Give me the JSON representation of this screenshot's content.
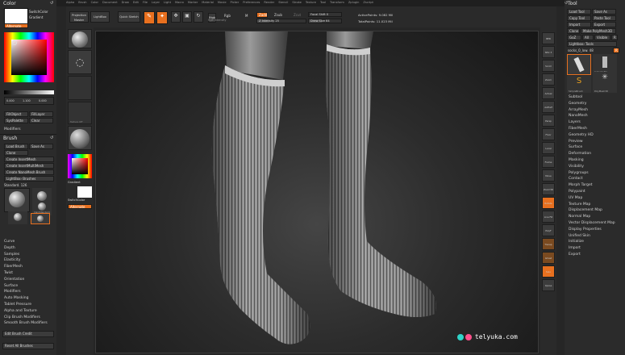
{
  "menu": {
    "items": [
      "Alpha",
      "Brush",
      "Color",
      "Document",
      "Draw",
      "Edit",
      "File",
      "Layer",
      "Light",
      "Macro",
      "Marker",
      "Material",
      "Movie",
      "Picker",
      "Preferences",
      "Render",
      "Stencil",
      "Stroke",
      "Texture",
      "Tool",
      "Transform",
      "Zplugin",
      "Zscript"
    ]
  },
  "toolbar": {
    "projection_label": "Projection Master",
    "lightbox_label": "LightBox",
    "quicksketch_label": "Quick Sketch",
    "edit_label": "Edit",
    "draw_label": "Draw",
    "move_label": "Move",
    "scale_label": "Scale",
    "rotate_label": "Rotate",
    "mrgb_label": "Mrgb",
    "rgb_label": "Rgb",
    "m_label": "M",
    "rgb_intensity_label": "Rgb Intensity",
    "zadd_label": "Zadd",
    "zsub_label": "Zsub",
    "zcut_label": "Zcut",
    "z_intensity_label": "Z Intensity 25",
    "focal_shift_label": "Focal Shift 0",
    "draw_size_label": "Draw Size 64",
    "active_points_label": "ActivePoints: 9.082 Mil",
    "total_points_label": "TotalPoints: 11.023 Mil"
  },
  "left": {
    "color_title": "Color",
    "switchcolor": "SwitchColor",
    "gradient": "Gradient",
    "alternate": "Alternate",
    "slider_values": [
      "0.000",
      "1.100",
      "0.000"
    ],
    "fill_object": "FillObject",
    "fill_layer": "FillLayer",
    "sys_palette": "SysPalette",
    "clear": "Clear",
    "modifiers": "Modifiers",
    "brush_title": "Brush",
    "load_brush": "Load Brush",
    "save_as": "Save As",
    "clone": "Clone",
    "lightbox_brushes": "LightBox› Brushes",
    "create_insertmesh": "Create InsertMesh",
    "create_insertmultimesh": "Create InsertMultiMesh",
    "create_nanomesh": "Create NanoMesh Brush",
    "standard_label": "Standard. 126",
    "brush_slots": [
      "Standard",
      "ClayBuildup",
      "DamStandard",
      "Move"
    ],
    "menu_items": [
      "Curve",
      "Depth",
      "Samples",
      "Elasticity",
      "FiberMesh",
      "Twist",
      "Orientation",
      "Surface",
      "Modifiers",
      "Auto Masking",
      "Tablet Pressure",
      "Alpha and Texture",
      "Clip Brush Modifiers",
      "Smooth Brush Modifiers"
    ],
    "edit_brush_credit": "Edit Brush Credit",
    "reset_all_brushes": "Reset All Brushes"
  },
  "shelf": {
    "texture_off": "Texture Off",
    "gradient": "Gradient",
    "switchcolor": "SwitchColor",
    "alternate": "Alternate"
  },
  "rightshelf": {
    "labels": [
      "BPR",
      "SPix 3",
      "Scroll",
      "Zoom",
      "Actual",
      "AAHalf",
      "Persp",
      "Floor",
      "Local",
      "Frame",
      "Move",
      "Zoom3D",
      "Rotate",
      "Line Fill",
      "PolyF",
      "Transp",
      "Ghost",
      "Solo",
      "Xpose"
    ]
  },
  "tool": {
    "title": "Tool",
    "load_tool": "Load Tool",
    "save_as": "Save As",
    "copy_tool": "Copy Tool",
    "paste_tool": "Paste Tool",
    "import": "Import",
    "export": "Export",
    "clone": "Clone",
    "make_polymesh": "Make PolyMesh3D",
    "goz": "GoZ",
    "all": "All",
    "visible": "Visible",
    "r": "R",
    "lightbox_tools": "Lightbox› Tools",
    "socks_label": "socks_0_low. 48",
    "thumb_labels": [
      "socks_0_low",
      "Cylinder3D",
      "PolyMesh3D",
      "SimpleBrush",
      "PM3D_Sock"
    ],
    "menu_items": [
      "Subtool",
      "Geometry",
      "ArrayMesh",
      "NanoMesh",
      "Layers",
      "FiberMesh",
      "Geometry HD",
      "Preview",
      "Surface",
      "Deformation",
      "Masking",
      "Visibility",
      "Polygroups",
      "Contact",
      "Morph Target",
      "Polypaint",
      "UV Map",
      "Texture Map",
      "Displacement Map",
      "Normal Map",
      "Vector Displacement Map",
      "Display Properties",
      "Unified Skin",
      "Initialize",
      "Import",
      "Export"
    ]
  },
  "watermark": {
    "text": "telyuka.com"
  },
  "colors": {
    "accent": "#e8701f",
    "panel": "#2b2b2b",
    "canvas": "#161616"
  }
}
